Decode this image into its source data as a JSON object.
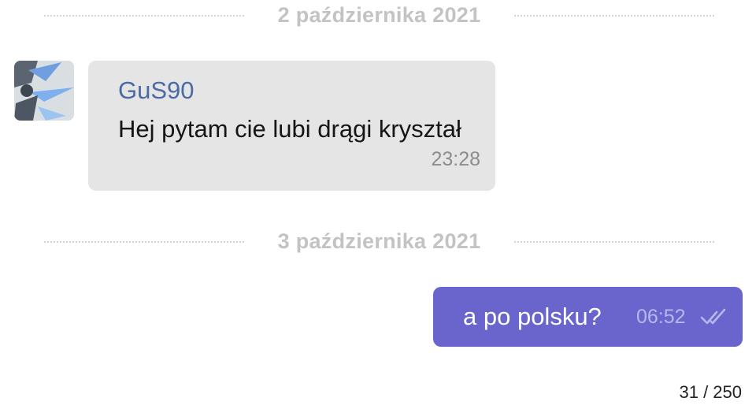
{
  "dates": {
    "first": "2 października 2021",
    "second": "3 października 2021"
  },
  "incoming": {
    "avatar_icon": "user-avatar-image",
    "sender": "GuS90",
    "text": "Hej pytam cie lubi drągi kryształ",
    "time": "23:28",
    "bubble_color": "#e5e5e5",
    "sender_color": "#4a6aa5"
  },
  "outgoing": {
    "text": "a po polsku?",
    "time": "06:52",
    "status_icon": "double-check-icon",
    "bubble_color": "#6a65cd"
  },
  "counter": "31 / 250"
}
